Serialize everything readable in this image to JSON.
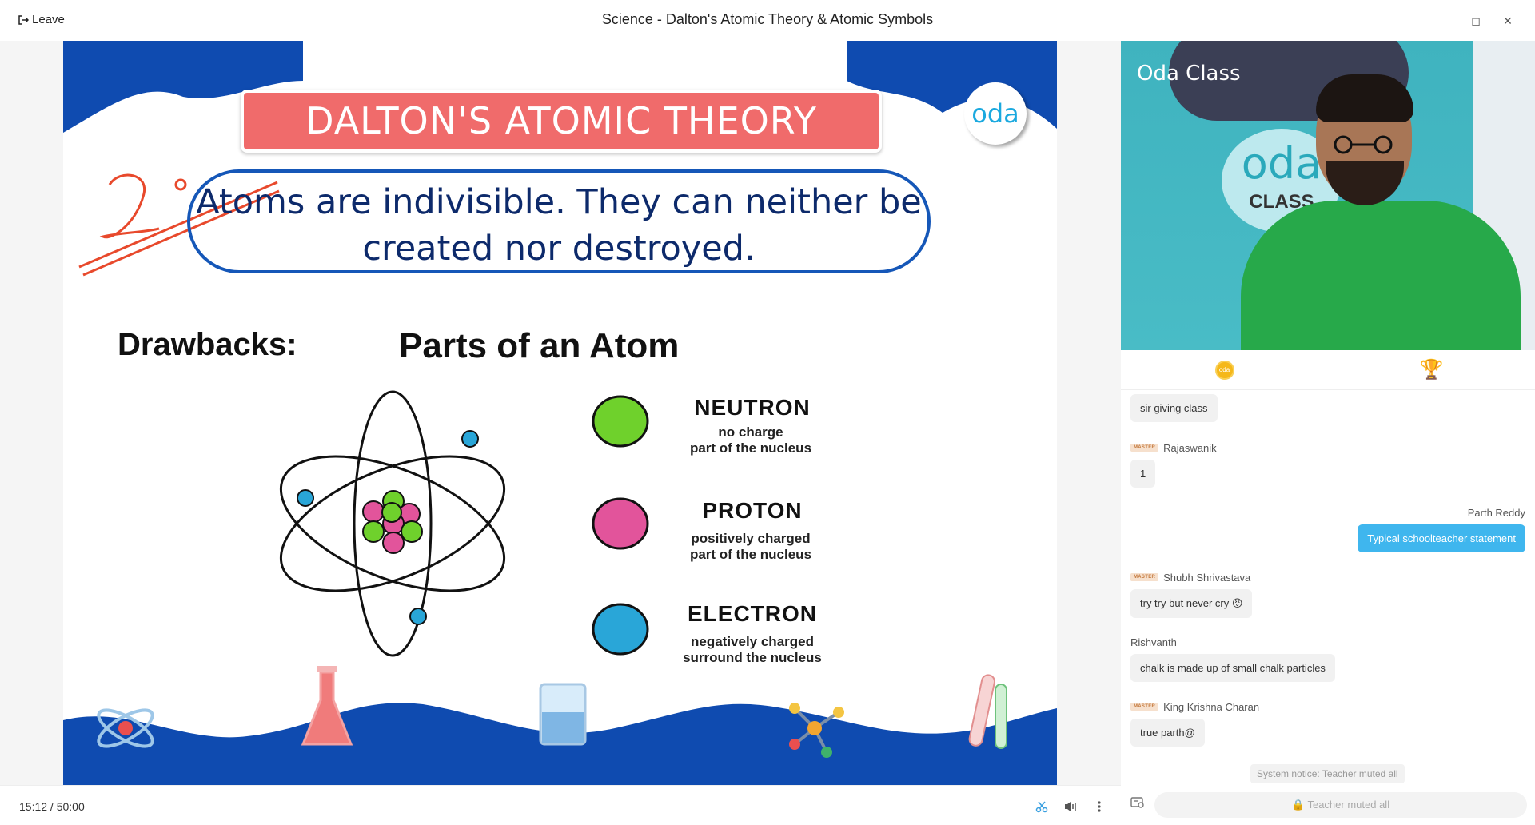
{
  "window": {
    "title": "Science - Dalton's Atomic Theory & Atomic Symbols",
    "leave_label": "Leave",
    "controls": [
      "minimize",
      "maximize",
      "close"
    ]
  },
  "slide": {
    "banner": "DALTON'S ATOMIC THEORY",
    "brand": "oda",
    "statement_line1": "Atoms are indivisible. They can neither be",
    "statement_line2": "created nor destroyed.",
    "annotation": "2°",
    "drawbacks_label": "Drawbacks:",
    "diagram_title": "Parts of an Atom",
    "particles": [
      {
        "name": "NEUTRON",
        "desc1": "no charge",
        "desc2": "part of the nucleus",
        "color": "#6fd12c"
      },
      {
        "name": "PROTON",
        "desc1": "positively charged",
        "desc2": "part of the nucleus",
        "color": "#e2549b"
      },
      {
        "name": "ELECTRON",
        "desc1": "negatively charged",
        "desc2": "surround the nucleus",
        "color": "#29a6d8"
      }
    ]
  },
  "video": {
    "logo_text": "Oda Class",
    "sign_text": "oda",
    "sign_sub": "CLASS"
  },
  "panel_tabs": [
    "coin",
    "trophy"
  ],
  "chat": {
    "messages": [
      {
        "sender": "",
        "badge": "",
        "text": "sir giving class",
        "mine": false
      },
      {
        "sender": "Rajaswanik",
        "badge": "MASTER",
        "text": "1",
        "mine": false
      },
      {
        "sender": "Parth Reddy",
        "badge": "",
        "text": "Typical schoolteacher statement",
        "mine": true
      },
      {
        "sender": "Shubh Shrivastava",
        "badge": "MASTER",
        "text": "try try but never cry 😝",
        "mine": false
      },
      {
        "sender": "Rishvanth",
        "badge": "",
        "text": "chalk is made up of small chalk particles",
        "mine": false
      },
      {
        "sender": "King Krishna Charan",
        "badge": "MASTER",
        "text": "true parth@",
        "mine": false
      }
    ],
    "system_notice": "System notice: Teacher muted all",
    "input_placeholder": "Teacher muted all"
  },
  "player": {
    "timecode": "15:12  /  50:00"
  },
  "colors": {
    "banner": "#f06b6b",
    "slide_wave": "#0f4bb0",
    "chat_mine": "#3fb6ee",
    "oda_blue": "#1ba9df"
  }
}
